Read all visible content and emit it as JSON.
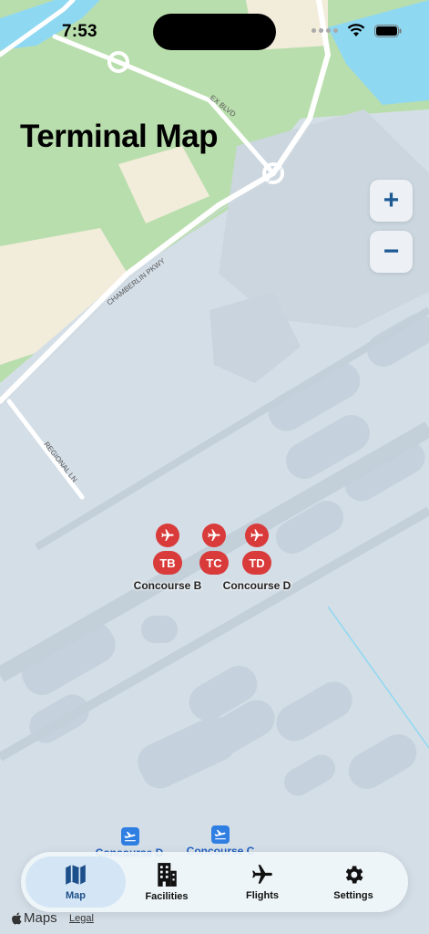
{
  "status_bar": {
    "time": "7:53"
  },
  "header": {
    "title": "Terminal Map"
  },
  "zoom": {
    "in_label": "+",
    "out_label": "−"
  },
  "map": {
    "roads": [
      "EX BLVD",
      "CHAMBERLIN PKWY",
      "REGIONAL LN"
    ],
    "pins": [
      {
        "code": "TB"
      },
      {
        "code": "TC"
      },
      {
        "code": "TD"
      }
    ],
    "pin_labels": [
      "Concourse B",
      "Concourse D"
    ],
    "gate_labels": [
      "Concourse D",
      "Concourse C"
    ],
    "colors": {
      "pin": "#d93a3a",
      "water": "#8fd8f2",
      "park": "#b7ddaa",
      "tarmac": "#d2dde6"
    }
  },
  "tabs": [
    {
      "label": "Map",
      "icon": "map-icon",
      "active": true
    },
    {
      "label": "Facilities",
      "icon": "building-icon",
      "active": false
    },
    {
      "label": "Flights",
      "icon": "airplane-icon",
      "active": false
    },
    {
      "label": "Settings",
      "icon": "gear-icon",
      "active": false
    }
  ],
  "attribution": {
    "brand": "Maps",
    "legal": "Legal"
  },
  "accent_color": "#1d5a94"
}
